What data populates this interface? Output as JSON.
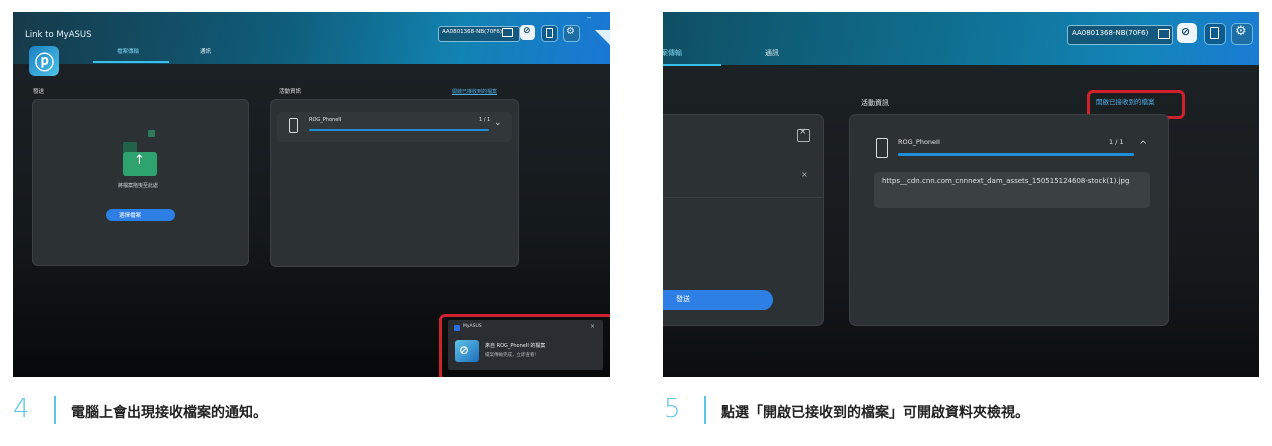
{
  "step4": {
    "number": "4",
    "caption": "電腦上會出現接收檔案的通知。",
    "app_title": "Link to MyASUS",
    "minimize_label": "_",
    "device_name": "AA0801368-NB(70F6)",
    "tabs": {
      "file_transfer": "檔案傳輸",
      "chat": "通訊"
    },
    "send_label": "發送",
    "drop_hint": "將檔案拖曳至此處",
    "choose_file_button": "選擇檔案",
    "activity_label": "活動資訊",
    "open_received_link": "開啟已接收到的檔案",
    "transfer": {
      "device": "ROG_PhoneII",
      "count": "1 / 1",
      "progress": 1.0
    },
    "notification": {
      "app": "MyASUS",
      "title": "來自 ROG_PhoneII 的檔案",
      "body": "檔案傳輸完成，立即查看！",
      "close": "×"
    }
  },
  "step5": {
    "number": "5",
    "caption": "點選「開啟已接收到的檔案」可開啟資料夾檢視。",
    "device_name": "AA0801368-NB(70F6)",
    "tabs": {
      "file_transfer": "案傳輸",
      "chat": "通訊"
    },
    "send_button": "發送",
    "activity_label": "活動資訊",
    "open_received_link": "開啟已接收到的檔案",
    "transfer": {
      "device": "ROG_PhoneII",
      "count": "1 / 1",
      "progress": 1.0,
      "file_name": "https__cdn.cnn.com_cnnnext_dam_assets_150515124608-stock(1).jpg"
    },
    "close_boxed": "×",
    "close_plain": "×"
  },
  "icons": {
    "link": "⊘",
    "settings": "⚙",
    "folder_arrow": "↑",
    "chevron_down": "⌄",
    "chevron_up": "^",
    "logo": "ⓟ"
  },
  "colors": {
    "accent": "#39c0e8",
    "highlight": "#d0222d",
    "button": "#2d7fe6",
    "caption_accent": "#5cc6e8"
  }
}
